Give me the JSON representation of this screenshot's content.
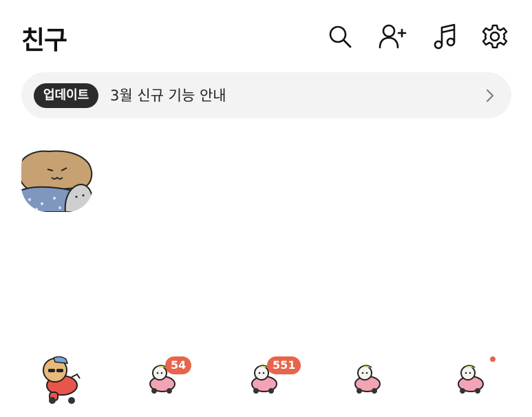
{
  "header": {
    "title": "친구",
    "icons": [
      "search-icon",
      "add-friend-icon",
      "music-icon",
      "settings-icon"
    ]
  },
  "banner": {
    "badge": "업데이트",
    "text": "3월 신규 기능 안내"
  },
  "tabs": [
    {
      "name": "friends",
      "active": true,
      "badge": ""
    },
    {
      "name": "chats",
      "active": false,
      "badge": "54"
    },
    {
      "name": "openchat",
      "active": false,
      "badge": "551"
    },
    {
      "name": "shopping",
      "active": false,
      "badge": ""
    },
    {
      "name": "more",
      "active": false,
      "badge": "",
      "dot": true
    }
  ],
  "colors": {
    "accent_badge": "#e8644a",
    "banner_bg": "#f3f3f3",
    "badge_bg": "#2b2b2b"
  }
}
